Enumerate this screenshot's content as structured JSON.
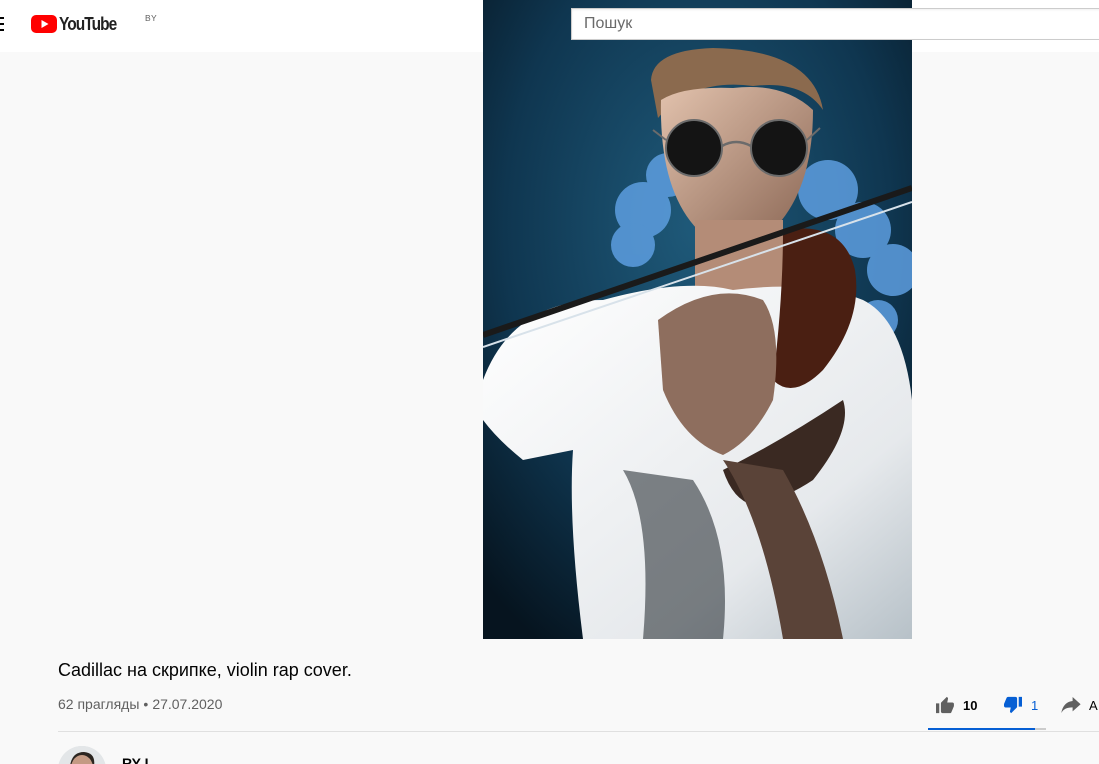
{
  "masthead": {
    "logo_text": "YouTube",
    "country_code": "BY",
    "brand_color": "#ff0000",
    "icons": [
      "menu-icon",
      "youtube-logo-icon"
    ]
  },
  "search": {
    "placeholder": "Пошук",
    "value": ""
  },
  "player": {
    "thumbnail_subject": "violinist in white t-shirt and sunglasses",
    "background_color": "#0c2a3c"
  },
  "video": {
    "title": "Cadillac на скрипке, violin rap cover.",
    "views": "62 прагляды",
    "separator": "•",
    "date": "27.07.2020"
  },
  "actions": {
    "like_count": "10",
    "dislike_count": "1",
    "share_label": "А",
    "dislike_active": true,
    "like_ratio": 0.91,
    "accent_color": "#065fd4",
    "icons": [
      "thumb-up-icon",
      "thumb-down-icon",
      "share-icon"
    ]
  },
  "owner": {
    "name": "RY L"
  }
}
